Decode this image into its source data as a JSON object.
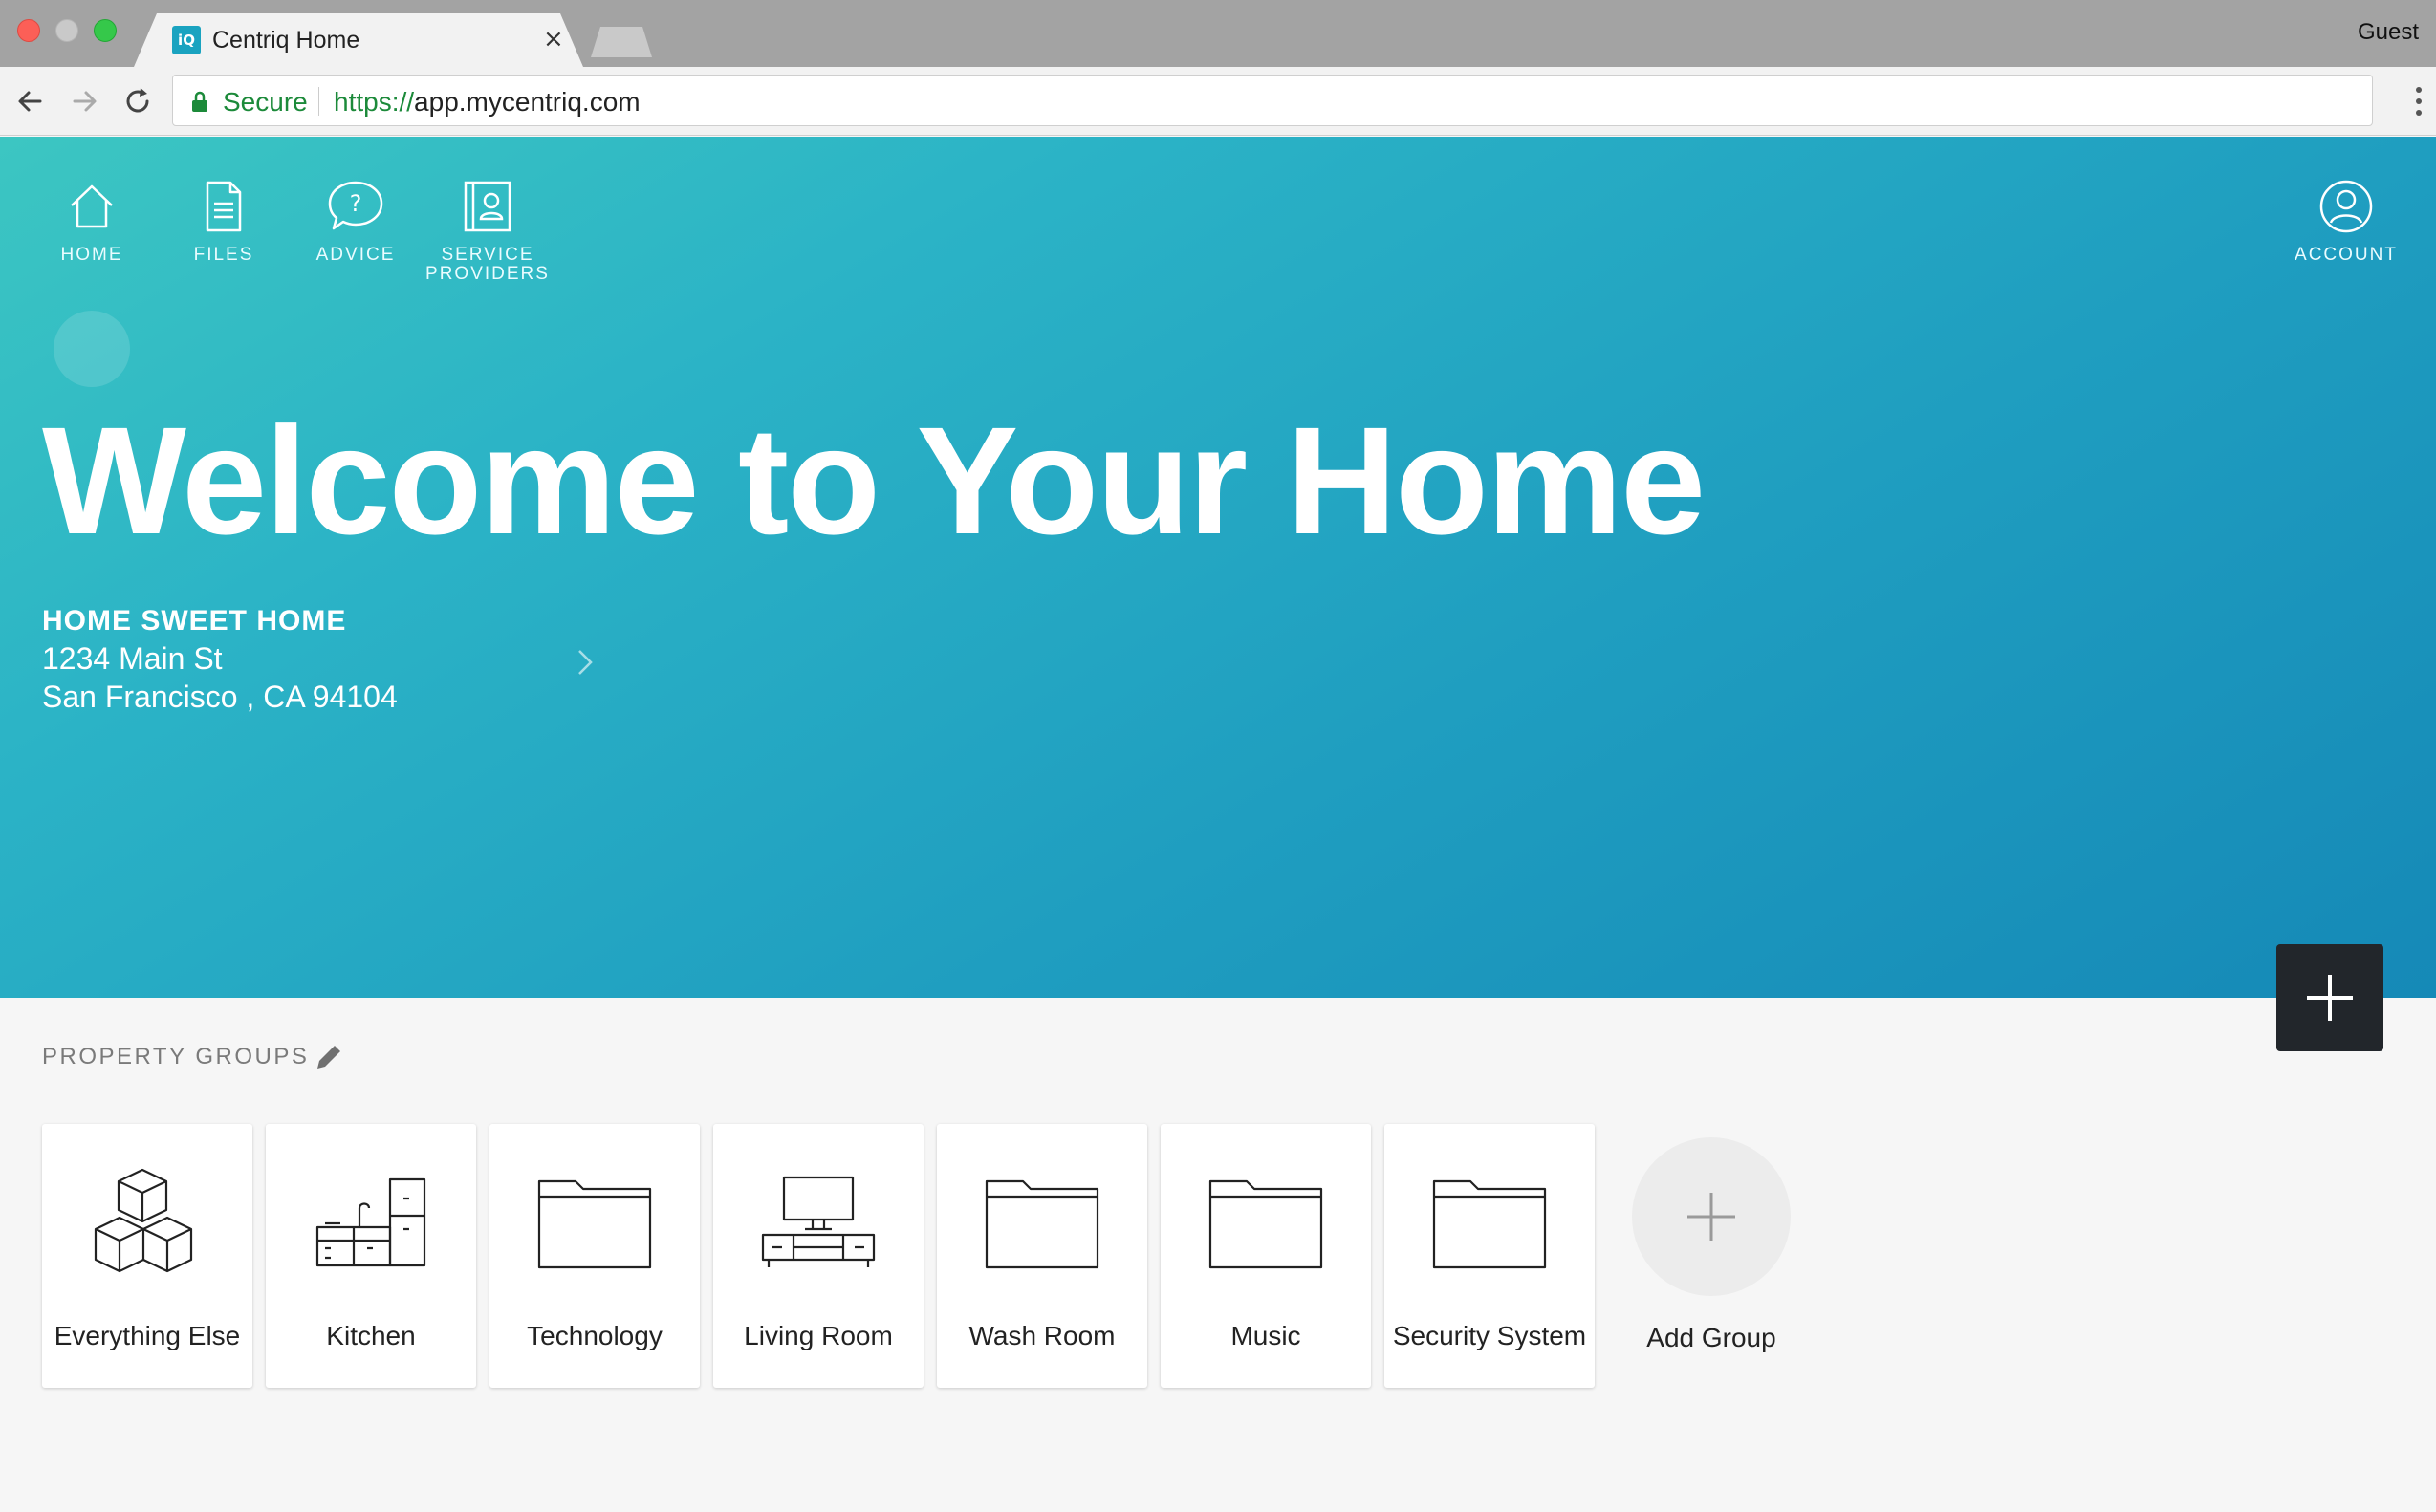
{
  "browser": {
    "tab_title": "Centriq Home",
    "tab_favicon_text": "iQ",
    "tab_close": "×",
    "profile": "Guest",
    "secure_label": "Secure",
    "url_scheme": "https://",
    "url_host": "app.mycentriq.com"
  },
  "nav": {
    "items": [
      {
        "label": "HOME",
        "icon": "home-icon"
      },
      {
        "label": "FILES",
        "icon": "file-icon"
      },
      {
        "label": "ADVICE",
        "icon": "help-bubble-icon"
      },
      {
        "label_line1": "SERVICE",
        "label_line2": "PROVIDERS",
        "icon": "contact-book-icon"
      }
    ],
    "account": {
      "label": "ACCOUNT",
      "icon": "user-icon"
    }
  },
  "hero": {
    "title": "Welcome to Your Home",
    "home_name": "HOME SWEET HOME",
    "address_line1": "1234 Main St",
    "address_line2": "San Francisco , CA 94104"
  },
  "property_groups": {
    "title": "PROPERTY GROUPS",
    "groups": [
      {
        "label": "Everything Else",
        "icon": "boxes-icon"
      },
      {
        "label": "Kitchen",
        "icon": "kitchen-icon"
      },
      {
        "label": "Technology",
        "icon": "folder-icon"
      },
      {
        "label": "Living Room",
        "icon": "tv-stand-icon"
      },
      {
        "label": "Wash Room",
        "icon": "folder-icon"
      },
      {
        "label": "Music",
        "icon": "folder-icon"
      },
      {
        "label": "Security System",
        "icon": "folder-icon"
      }
    ],
    "add_label": "Add Group"
  },
  "colors": {
    "hero_start": "#3cc6c2",
    "hero_end": "#1589b7",
    "fab": "#22262b",
    "secure_green": "#1c8a3a"
  }
}
